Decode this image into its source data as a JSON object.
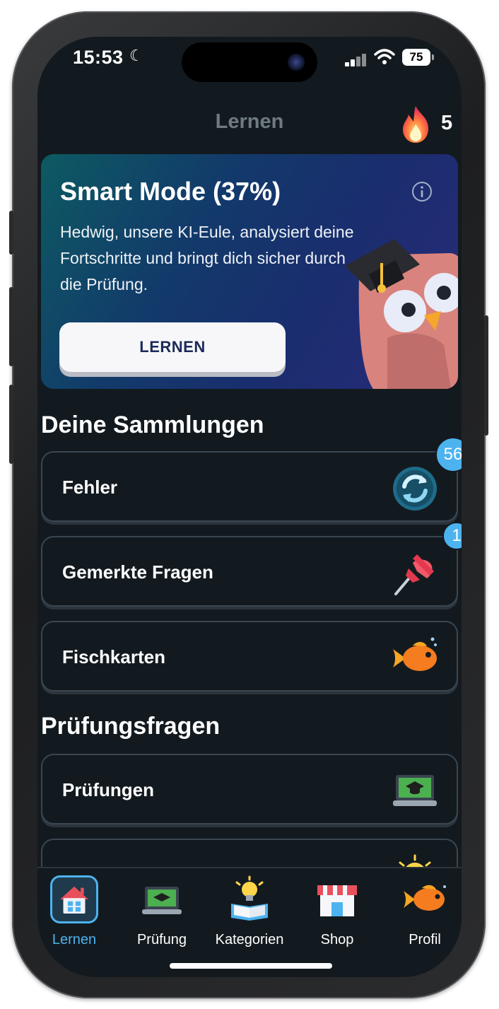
{
  "status_bar": {
    "time": "15:53",
    "battery": "75"
  },
  "header": {
    "title": "Lernen",
    "streak_count": "5"
  },
  "smart_mode": {
    "title": "Smart Mode (37%)",
    "description": "Hedwig, unsere KI-Eule, analysiert deine Fortschritte und bringt dich sicher durch die Prüfung.",
    "button_label": "LERNEN"
  },
  "collections": {
    "title": "Deine Sammlungen",
    "items": [
      {
        "label": "Fehler",
        "badge": "56",
        "icon": "refresh-icon"
      },
      {
        "label": "Gemerkte Fragen",
        "badge": "1",
        "icon": "pushpin-icon"
      },
      {
        "label": "Fischkarten",
        "icon": "fish-icon"
      }
    ]
  },
  "exam_questions": {
    "title": "Prüfungsfragen",
    "items": [
      {
        "label": "Prüfungen",
        "icon": "laptop-graduation-icon"
      },
      {
        "label": "",
        "icon": "lightbulb-icon"
      }
    ]
  },
  "tabbar": {
    "items": [
      {
        "label": "Lernen",
        "icon": "house-icon",
        "active": true
      },
      {
        "label": "Prüfung",
        "icon": "laptop-graduation-icon"
      },
      {
        "label": "Kategorien",
        "icon": "book-lightbulb-icon"
      },
      {
        "label": "Shop",
        "icon": "shop-icon"
      },
      {
        "label": "Profil",
        "icon": "fish-icon"
      }
    ]
  },
  "colors": {
    "accent": "#4db3ef",
    "background": "#131a1f",
    "card_border": "#3a4650"
  }
}
